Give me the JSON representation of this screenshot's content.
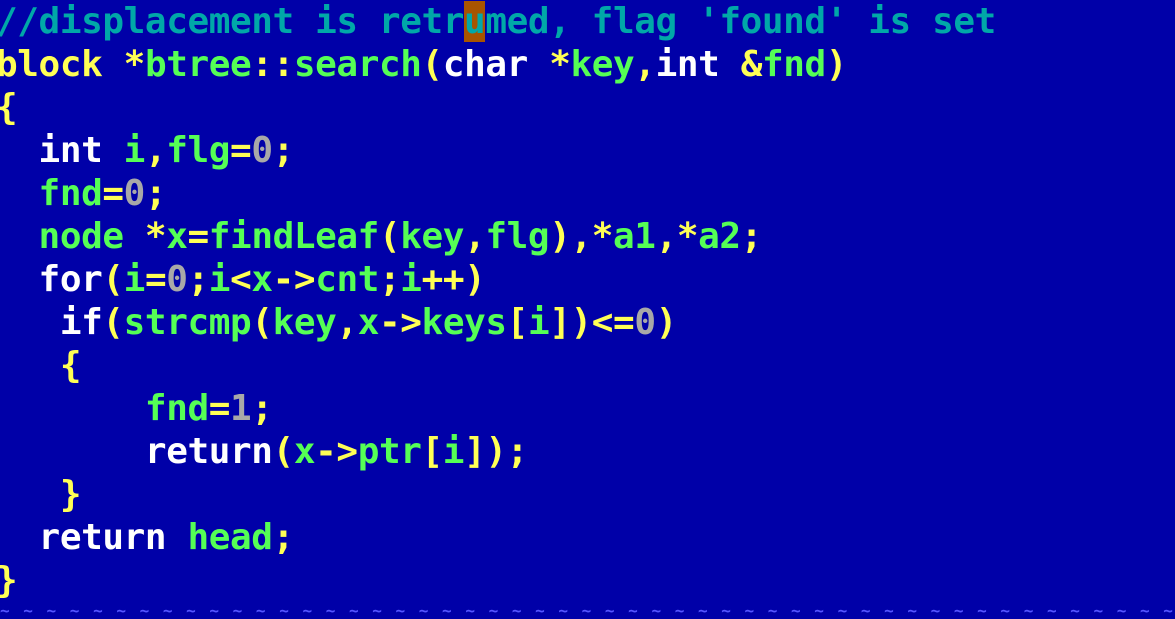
{
  "editor": {
    "cursor_line": 0,
    "cursor_token": 2,
    "lines": [
      [
        {
          "t": "//displacement is retr",
          "c": "c-comment"
        },
        {
          "t": "u",
          "c": "c-comment cursor"
        },
        {
          "t": "med, flag 'found' is set",
          "c": "c-comment"
        }
      ],
      [
        {
          "t": "block ",
          "c": "c-type"
        },
        {
          "t": "*",
          "c": "c-punct"
        },
        {
          "t": "btree",
          "c": "c-ident"
        },
        {
          "t": "::",
          "c": "c-punct"
        },
        {
          "t": "search",
          "c": "c-ident"
        },
        {
          "t": "(",
          "c": "c-punct"
        },
        {
          "t": "char ",
          "c": "c-kw"
        },
        {
          "t": "*",
          "c": "c-punct"
        },
        {
          "t": "key",
          "c": "c-ident"
        },
        {
          "t": ",",
          "c": "c-punct"
        },
        {
          "t": "int ",
          "c": "c-kw"
        },
        {
          "t": "&",
          "c": "c-punct"
        },
        {
          "t": "fnd",
          "c": "c-ident"
        },
        {
          "t": ")",
          "c": "c-punct"
        }
      ],
      [
        {
          "t": "{",
          "c": "c-punct"
        }
      ],
      [
        {
          "t": "  int ",
          "c": "c-kw"
        },
        {
          "t": "i",
          "c": "c-ident"
        },
        {
          "t": ",",
          "c": "c-punct"
        },
        {
          "t": "flg",
          "c": "c-ident"
        },
        {
          "t": "=",
          "c": "c-punct"
        },
        {
          "t": "0",
          "c": "c-num"
        },
        {
          "t": ";",
          "c": "c-punct"
        }
      ],
      [
        {
          "t": "  fnd",
          "c": "c-ident"
        },
        {
          "t": "=",
          "c": "c-punct"
        },
        {
          "t": "0",
          "c": "c-num"
        },
        {
          "t": ";",
          "c": "c-punct"
        }
      ],
      [
        {
          "t": "  node ",
          "c": "c-ident"
        },
        {
          "t": "*",
          "c": "c-punct"
        },
        {
          "t": "x",
          "c": "c-ident"
        },
        {
          "t": "=",
          "c": "c-punct"
        },
        {
          "t": "findLeaf",
          "c": "c-ident"
        },
        {
          "t": "(",
          "c": "c-punct"
        },
        {
          "t": "key",
          "c": "c-ident"
        },
        {
          "t": ",",
          "c": "c-punct"
        },
        {
          "t": "flg",
          "c": "c-ident"
        },
        {
          "t": "),",
          "c": "c-punct"
        },
        {
          "t": "*",
          "c": "c-punct"
        },
        {
          "t": "a1",
          "c": "c-ident"
        },
        {
          "t": ",",
          "c": "c-punct"
        },
        {
          "t": "*",
          "c": "c-punct"
        },
        {
          "t": "a2",
          "c": "c-ident"
        },
        {
          "t": ";",
          "c": "c-punct"
        }
      ],
      [
        {
          "t": "  for",
          "c": "c-kw"
        },
        {
          "t": "(",
          "c": "c-punct"
        },
        {
          "t": "i",
          "c": "c-ident"
        },
        {
          "t": "=",
          "c": "c-punct"
        },
        {
          "t": "0",
          "c": "c-num"
        },
        {
          "t": ";",
          "c": "c-punct"
        },
        {
          "t": "i",
          "c": "c-ident"
        },
        {
          "t": "<",
          "c": "c-punct"
        },
        {
          "t": "x",
          "c": "c-ident"
        },
        {
          "t": "->",
          "c": "c-punct"
        },
        {
          "t": "cnt",
          "c": "c-ident"
        },
        {
          "t": ";",
          "c": "c-punct"
        },
        {
          "t": "i",
          "c": "c-ident"
        },
        {
          "t": "++)",
          "c": "c-punct"
        }
      ],
      [
        {
          "t": "   if",
          "c": "c-kw"
        },
        {
          "t": "(",
          "c": "c-punct"
        },
        {
          "t": "strcmp",
          "c": "c-ident"
        },
        {
          "t": "(",
          "c": "c-punct"
        },
        {
          "t": "key",
          "c": "c-ident"
        },
        {
          "t": ",",
          "c": "c-punct"
        },
        {
          "t": "x",
          "c": "c-ident"
        },
        {
          "t": "->",
          "c": "c-punct"
        },
        {
          "t": "keys",
          "c": "c-ident"
        },
        {
          "t": "[",
          "c": "c-punct"
        },
        {
          "t": "i",
          "c": "c-ident"
        },
        {
          "t": "])<=",
          "c": "c-punct"
        },
        {
          "t": "0",
          "c": "c-num"
        },
        {
          "t": ")",
          "c": "c-punct"
        }
      ],
      [
        {
          "t": "   {",
          "c": "c-punct"
        }
      ],
      [
        {
          "t": "       fnd",
          "c": "c-ident"
        },
        {
          "t": "=",
          "c": "c-punct"
        },
        {
          "t": "1",
          "c": "c-num"
        },
        {
          "t": ";",
          "c": "c-punct"
        }
      ],
      [
        {
          "t": "       return",
          "c": "c-kw"
        },
        {
          "t": "(",
          "c": "c-punct"
        },
        {
          "t": "x",
          "c": "c-ident"
        },
        {
          "t": "->",
          "c": "c-punct"
        },
        {
          "t": "ptr",
          "c": "c-ident"
        },
        {
          "t": "[",
          "c": "c-punct"
        },
        {
          "t": "i",
          "c": "c-ident"
        },
        {
          "t": "]);",
          "c": "c-punct"
        }
      ],
      [
        {
          "t": "   }",
          "c": "c-punct"
        }
      ],
      [
        {
          "t": "  return ",
          "c": "c-kw"
        },
        {
          "t": "head",
          "c": "c-ident"
        },
        {
          "t": ";",
          "c": "c-punct"
        }
      ],
      [
        {
          "t": "}",
          "c": "c-punct"
        }
      ]
    ],
    "empty_line_marker": "~ ~ ~ ~ ~ ~ ~ ~ ~ ~ ~ ~ ~ ~ ~ ~ ~ ~ ~ ~ ~ ~ ~ ~ ~ ~ ~ ~ ~ ~ ~ ~ ~ ~ ~ ~ ~ ~ ~ ~ ~ ~ ~ ~ ~ ~ ~ ~ ~ ~ ~ ~ ~ ~ ~ ~ ~ ~ ~ ~ ~ ~ ~ ~ ~ ~ ~ ~ ~ ~ ~ ~ ~ ~ ~ ~ ~",
    "colors": {
      "background": "#0000a8",
      "comment": "#00a8a8",
      "type": "#ffff55",
      "keyword": "#ffffff",
      "identifier": "#55ff55",
      "number": "#a8a8a8",
      "cursor": "#a85400"
    }
  }
}
